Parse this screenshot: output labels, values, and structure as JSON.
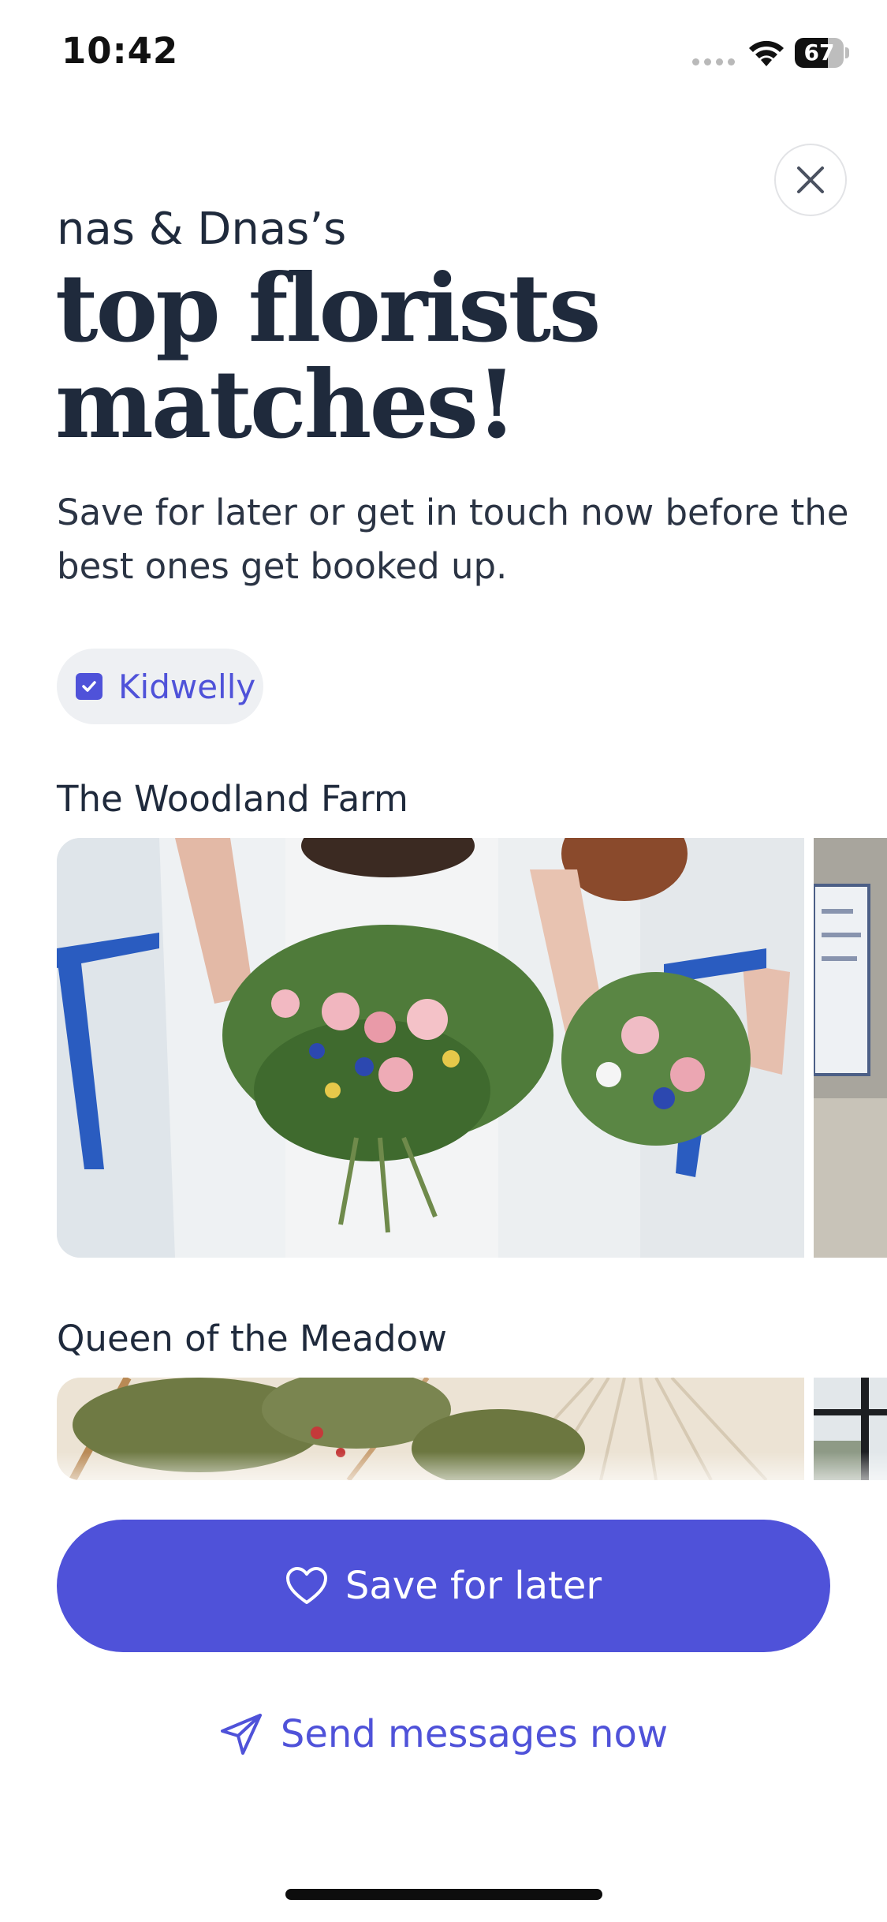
{
  "status_bar": {
    "time": "10:42",
    "battery_level": "67"
  },
  "header": {
    "subtitle": "nas & Dnas’s",
    "headline_line1": "top florists",
    "headline_line2": "matches!",
    "description": "Save for later or get in touch now before the best ones get booked up."
  },
  "filter_chip": {
    "label": "Kidwelly",
    "checked": true
  },
  "vendors": [
    {
      "name": "The Woodland Farm"
    },
    {
      "name": "Queen of the Meadow"
    }
  ],
  "actions": {
    "save_label": "Save for later",
    "send_label": "Send messages now"
  },
  "icons": {
    "close": "close-icon",
    "chip_check": "checkbox-checked-icon",
    "save": "heart-icon",
    "send": "paper-plane-icon",
    "wifi": "wifi-icon",
    "battery": "battery-icon"
  },
  "colors": {
    "accent": "#4f52d9",
    "text_dark": "#1f2a3c",
    "chip_bg": "#eef0f3"
  }
}
